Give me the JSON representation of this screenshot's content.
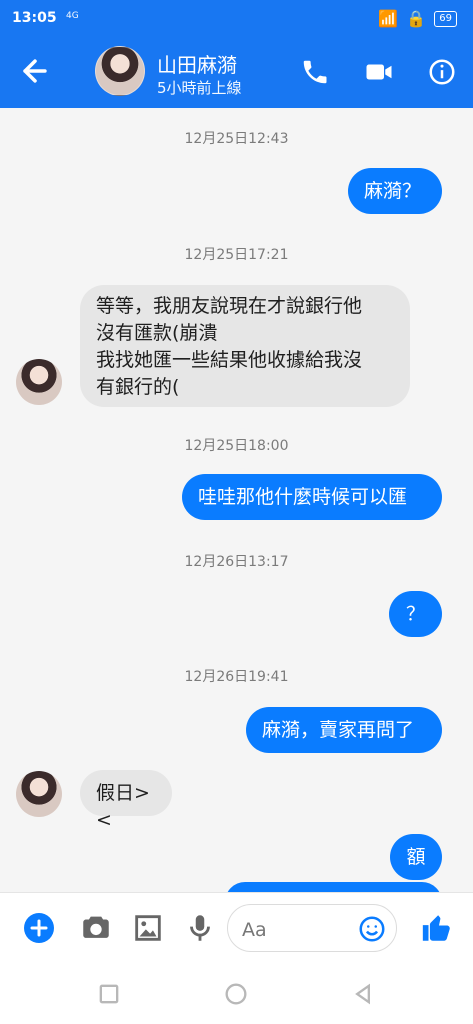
{
  "status": {
    "time": "13:05",
    "network": "4G",
    "battery": "69"
  },
  "header": {
    "name": "山田麻漪",
    "presence": "5小時前上線"
  },
  "messages": [
    {
      "type": "timestamp",
      "text": "12月25日12:43"
    },
    {
      "type": "outgoing",
      "text": "麻漪？"
    },
    {
      "type": "timestamp",
      "text": "12月25日17:21"
    },
    {
      "type": "incoming",
      "lines": [
        "等等，我朋友說現在才說銀行他",
        "沒有匯款(崩潰",
        "我找她匯一些結果他收據給我沒",
        "有銀行的("
      ]
    },
    {
      "type": "timestamp",
      "text": "12月25日18:00"
    },
    {
      "type": "outgoing",
      "text": "哇哇那他什麼時候可以匯"
    },
    {
      "type": "timestamp",
      "text": "12月26日13:17"
    },
    {
      "type": "outgoing",
      "text": "？"
    },
    {
      "type": "timestamp",
      "text": "12月26日19:41"
    },
    {
      "type": "outgoing",
      "text": "麻漪，賣家再問了"
    },
    {
      "type": "incoming",
      "text": "假日><"
    },
    {
      "type": "outgoing",
      "text": "額"
    }
  ],
  "composer": {
    "placeholder": "Aa"
  },
  "icons": {
    "back": "back-arrow-icon",
    "call": "phone-icon",
    "video": "video-camera-icon",
    "info": "info-icon",
    "add": "plus-icon",
    "camera": "camera-icon",
    "gallery": "image-icon",
    "mic": "microphone-icon",
    "emoji": "emoji-icon",
    "like": "thumbs-up-icon",
    "home": "home-circle-icon",
    "recent": "recent-square-icon",
    "back_nav": "back-triangle-icon"
  },
  "colors": {
    "brand": "#1877f2",
    "outgoing_bubble": "#0a7cff",
    "incoming_bubble": "#e6e6e6",
    "timestamp": "#7b7b7b"
  }
}
